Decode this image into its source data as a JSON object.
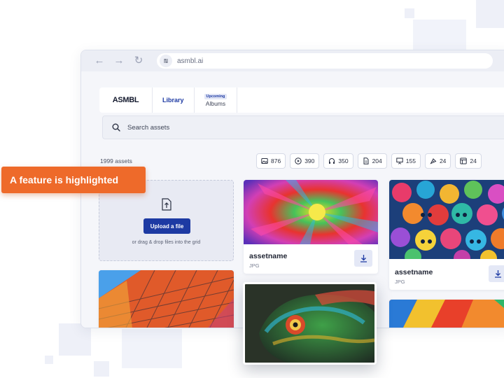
{
  "browser": {
    "url": "asmbl.ai",
    "nav_icons": [
      "back-arrow-icon",
      "forward-arrow-icon",
      "reload-icon",
      "site-settings-icon"
    ]
  },
  "app": {
    "logo_text": "ASMBL",
    "tabs": {
      "library": "Library",
      "albums_badge": "Upcoming",
      "albums": "Albums"
    },
    "search": {
      "placeholder": "Search assets"
    },
    "asset_count": "1999 assets",
    "filters": [
      {
        "icon": "image-icon",
        "count": "876"
      },
      {
        "icon": "video-play-icon",
        "count": "390"
      },
      {
        "icon": "headphones-icon",
        "count": "350"
      },
      {
        "icon": "document-icon",
        "count": "204"
      },
      {
        "icon": "presentation-icon",
        "count": "155"
      },
      {
        "icon": "vector-pen-icon",
        "count": "24"
      },
      {
        "icon": "template-icon",
        "count": "24"
      }
    ],
    "upload": {
      "button": "Upload a file",
      "hint": "or drag & drop files into the grid"
    },
    "cards": [
      {
        "name": "assetname",
        "type": "JPG"
      },
      {
        "name": "assetname",
        "type": "JPG"
      }
    ]
  },
  "callout": {
    "text": "A feature is highlighted"
  },
  "colors": {
    "accent": "#1d3aa3",
    "callout": "#ee6a2a",
    "chrome": "#eceef5",
    "page_bg": "#f5f6fa"
  }
}
